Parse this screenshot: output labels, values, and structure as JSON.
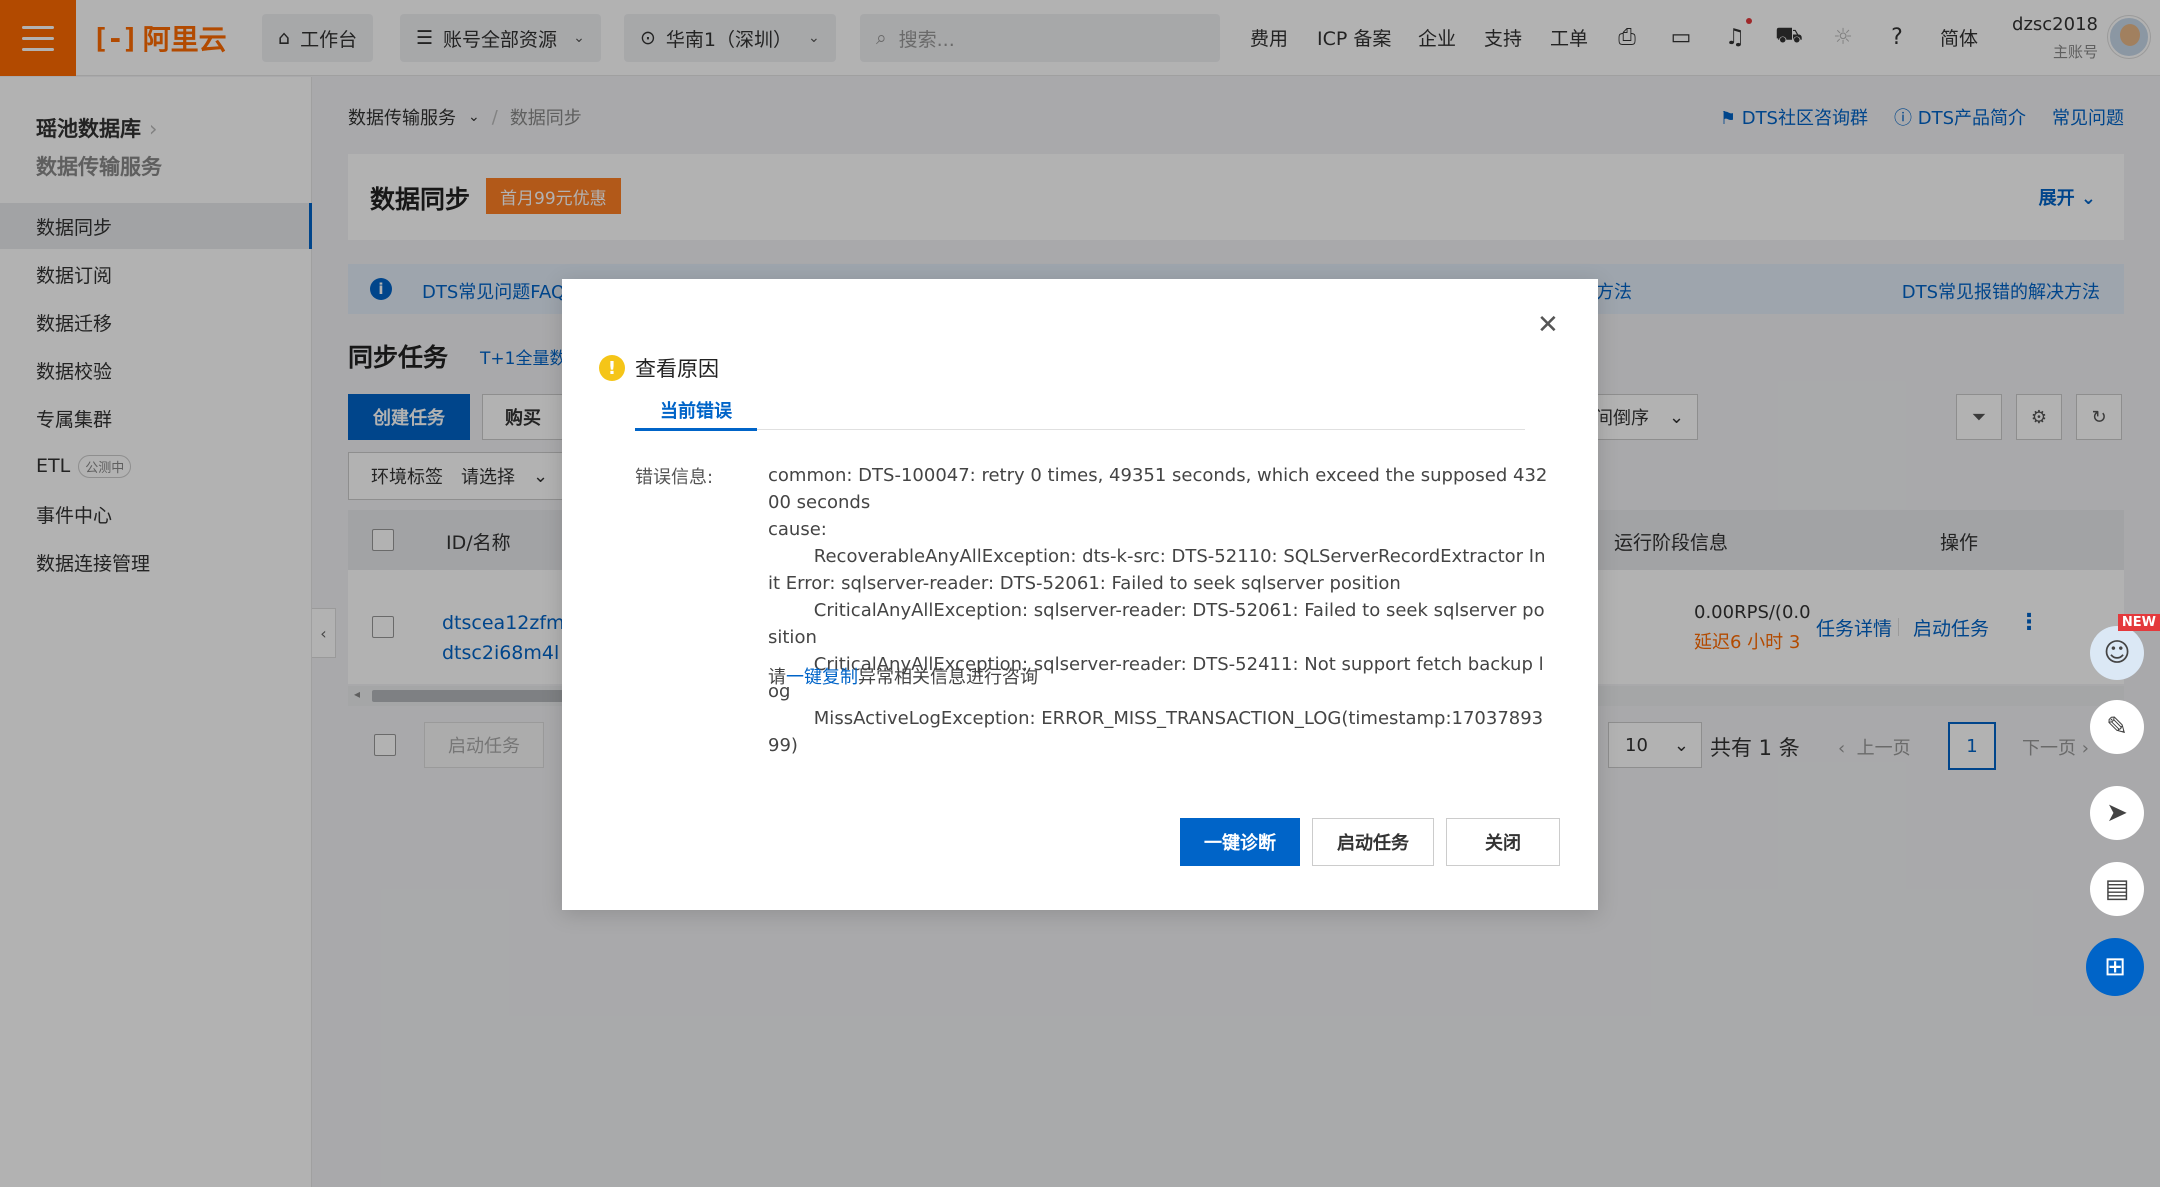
{
  "topbar": {
    "logo_text": "阿里云",
    "workbench": "工作台",
    "resources": "账号全部资源",
    "region": "华南1（深圳）",
    "search_placeholder": "搜索...",
    "links": [
      "费用",
      "ICP 备案",
      "企业",
      "支持",
      "工单"
    ],
    "lang": "简体",
    "username": "dzsc2018",
    "account_type": "主账号"
  },
  "sidebar": {
    "title": "瑶池数据库",
    "subtitle": "数据传输服务",
    "items": [
      {
        "label": "数据同步"
      },
      {
        "label": "数据订阅"
      },
      {
        "label": "数据迁移"
      },
      {
        "label": "数据校验"
      },
      {
        "label": "专属集群"
      },
      {
        "label": "ETL",
        "badge": "公测中"
      },
      {
        "label": "事件中心"
      },
      {
        "label": "数据连接管理"
      }
    ]
  },
  "breadcrumb": {
    "root": "数据传输服务",
    "current": "数据同步"
  },
  "help_links": [
    "DTS社区咨询群",
    "DTS产品简介",
    "常见问题"
  ],
  "header": {
    "title": "数据同步",
    "promo": "首月99元优惠",
    "expand": "展开"
  },
  "notice": {
    "left": "DTS常见问题FAQ",
    "middle": "方法",
    "right": "DTS常见报错的解决方法"
  },
  "sync": {
    "title": "同步任务",
    "subtitle": "T+1全量数",
    "create_btn": "创建任务",
    "buy_btn": "购买",
    "sort_label": "间倒序",
    "env_label": "环境标签",
    "env_placeholder": "请选择"
  },
  "table": {
    "col_id": "ID/名称",
    "col_stage": "运行阶段信息",
    "col_op": "操作",
    "row": {
      "id": "dtscea12zfm2",
      "name": "dtsc2i68m4l",
      "rps": "0.00RPS/(0.0",
      "delay": "延迟6 小时 3",
      "op_detail": "任务详情",
      "op_start": "启动任务"
    }
  },
  "pagination": {
    "start_btn": "启动任务",
    "page_size": "10",
    "total": "共有 1 条",
    "prev": "上一页",
    "current": "1",
    "next": "下一页"
  },
  "float_new": "NEW",
  "dialog": {
    "title": "查看原因",
    "tab": "当前错误",
    "label": "错误信息:",
    "message": "common: DTS-100047: retry 0 times, 49351 seconds, which exceed the supposed 43200 seconds\ncause:\n        RecoverableAnyAllException: dts-k-src: DTS-52110: SQLServerRecordExtractor Init Error: sqlserver-reader: DTS-52061: Failed to seek sqlserver position\n        CriticalAnyAllException: sqlserver-reader: DTS-52061: Failed to seek sqlserver position\n        CriticalAnyAllException: sqlserver-reader: DTS-52411: Not support fetch backup log\n        MissActiveLogException: ERROR_MISS_TRANSACTION_LOG(timestamp:1703789399)",
    "consult_pre": "请",
    "consult_link": "一键复制",
    "consult_post": "异常相关信息进行咨询",
    "btn_diagnose": "一键诊断",
    "btn_start": "启动任务",
    "btn_close": "关闭"
  }
}
